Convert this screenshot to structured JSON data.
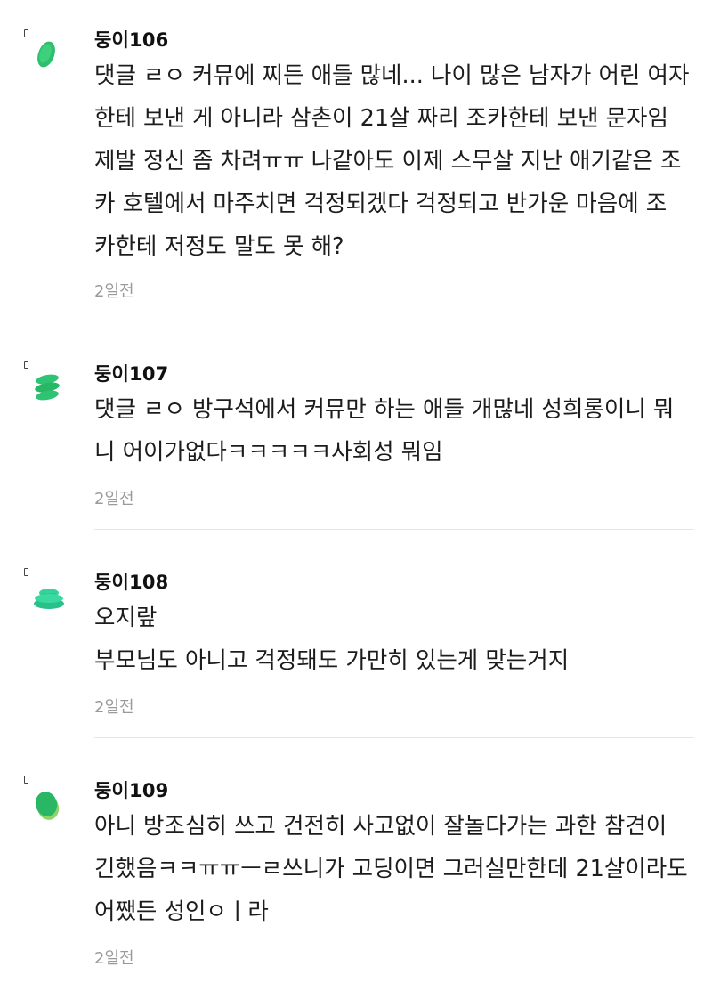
{
  "comments": [
    {
      "nickname": "둥이106",
      "avatar_icon": "green-leaf-icon",
      "lines": [
        "댓글 ㄹㅇ 커뮤에 찌든 애들 많네... 나이 많은 남자가 어린 여자",
        "한테 보낸 게 아니라 삼촌이 21살 짜리 조카한테 보낸 문자임",
        "제발 정신 좀 차려ㅠㅠ 나같아도 이제 스무살 지난 애기같은 조",
        "카 호텔에서 마주치면 걱정되겠다 걱정되고 반가운 마음에 조",
        "카한테 저정도 말도 못 해?"
      ],
      "time": "2일전"
    },
    {
      "nickname": "둥이107",
      "avatar_icon": "green-stack-icon",
      "lines": [
        "댓글 ㄹㅇ 방구석에서 커뮤만 하는 애들 개많네 성희롱이니 뭐",
        "니 어이가없다ㅋㅋㅋㅋㅋ사회성 뭐임"
      ],
      "time": "2일전"
    },
    {
      "nickname": "둥이108",
      "avatar_icon": "green-spool-icon",
      "lines": [
        "오지랖",
        "부모님도 아니고 걱정돼도 가만히 있는게 맞는거지"
      ],
      "time": "2일전"
    },
    {
      "nickname": "둥이109",
      "avatar_icon": "green-oval-icon",
      "lines": [
        "아니 방조심히 쓰고 건전히 사고없이 잘놀다가는 과한 참견이",
        "긴했음ㅋㅋㅠㅠㅡㄹ쓰니가 고딩이면 그러실만한데 21살이라도",
        "어쨌든 성인ㅇㅣ라"
      ],
      "time": "2일전"
    }
  ]
}
